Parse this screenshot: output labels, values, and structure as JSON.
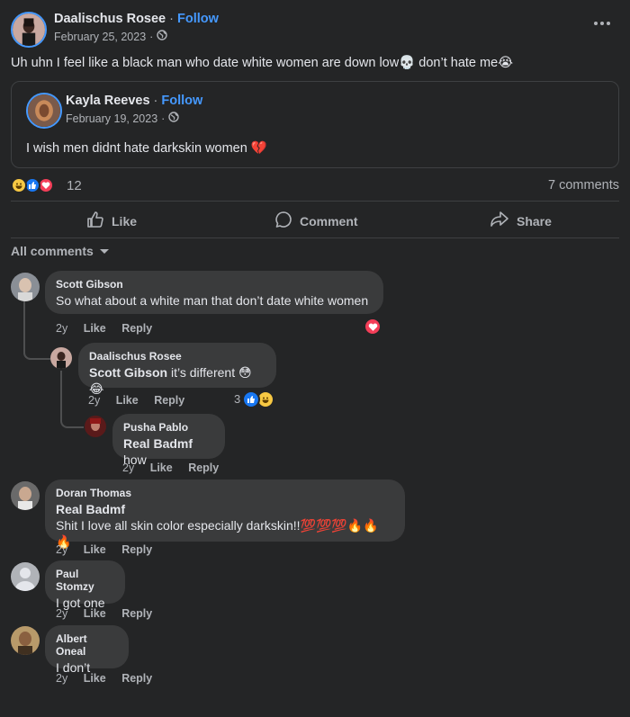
{
  "post": {
    "author": "Daalischus Rosee",
    "follow_label": "Follow",
    "date": "February 25, 2023",
    "text": "Uh uhn I feel like a black man who date white women are down low💀 don’t hate me😭",
    "more_icon": "more-options-icon"
  },
  "shared": {
    "author": "Kayla Reeves",
    "follow_label": "Follow",
    "date": "February 19, 2023",
    "text": "I wish men didnt hate darkskin women 💔"
  },
  "reactions": {
    "count": "12",
    "comments_label": "7 comments"
  },
  "action_bar": {
    "like": "Like",
    "comment": "Comment",
    "share": "Share"
  },
  "filter": {
    "label": "All comments"
  },
  "comments": [
    {
      "name": "Scott Gibson",
      "text": "So what about a white man that don’t date white women",
      "time": "2y",
      "like": "Like",
      "reply": "Reply"
    },
    {
      "name": "Daalischus Rosee",
      "tag": "Scott Gibson",
      "text": " it’s different 😳😂",
      "time": "2y",
      "like": "Like",
      "reply": "Reply",
      "reaction_count": "3"
    },
    {
      "name": "Pusha Pablo",
      "tag": "Real Badmf",
      "text": " how",
      "time": "2y",
      "like": "Like",
      "reply": "Reply"
    },
    {
      "name": "Doran Thomas",
      "tag": "Real Badmf",
      "text": "Shit I love all skin color especially darkskin!!💯💯💯🔥🔥🔥",
      "time": "2y",
      "like": "Like",
      "reply": "Reply"
    },
    {
      "name": "Paul Stomzy",
      "text": "I got one",
      "time": "2y",
      "like": "Like",
      "reply": "Reply"
    },
    {
      "name": "Albert Oneal",
      "text": "I don’t",
      "time": "2y",
      "like": "Like",
      "reply": "Reply"
    }
  ],
  "colors": {
    "background": "#242526",
    "bubble": "#3a3b3c",
    "link": "#4599ff",
    "secondary_text": "#b0b3b8"
  }
}
